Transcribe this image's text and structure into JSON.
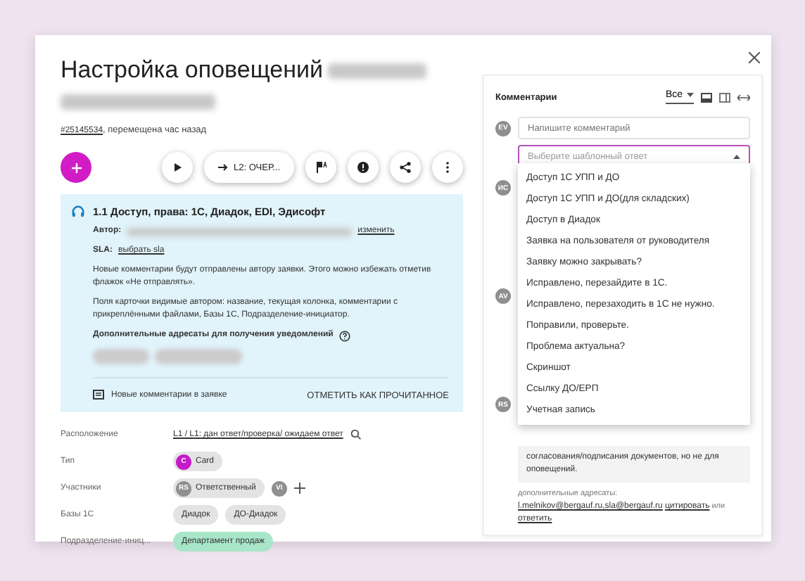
{
  "dialog": {
    "title": "Настройка оповещений",
    "ticket_link": "#25145534",
    "moved": ", перемещена час назад"
  },
  "toolbar": {
    "move_label": "L2: ОЧЕР..."
  },
  "info": {
    "heading": "1.1 Доступ, права: 1С, Диадок, EDI, Эдисофт",
    "author_label": "Автор:",
    "change_link": "изменить",
    "sla_label": "SLA:",
    "sla_link": "выбрать sla",
    "notes": [
      "Новые комментарии будут отправлены автору заявки. Этого можно избежать отметив флажок «Не отправлять».",
      "Поля карточки видимые автором: название, текущая колонка, комментарии с прикреплёнными файлами, Базы 1С, Подразделение-инициатор."
    ],
    "extra_heading": "Дополнительные адресаты для получения уведомлений",
    "new_comments": "Новые комментарии в заявке",
    "mark_read": "ОТМЕТИТЬ КАК ПРОЧИТАННОЕ"
  },
  "fields": [
    {
      "label": "Расположение",
      "kind": "location",
      "value": "L1 / L1: дан ответ/проверка/ ожидаем ответ"
    },
    {
      "label": "Тип",
      "kind": "type",
      "avatar": "C",
      "value": "Card"
    },
    {
      "label": "Участники",
      "kind": "participants",
      "role_initials": "RS",
      "role": "Ответственный",
      "extra_initials": "VI"
    },
    {
      "label": "Базы 1С",
      "kind": "tags",
      "tags": [
        "Диадок",
        "ДО-Диадок"
      ]
    },
    {
      "label": "Подразделение-иниц...",
      "kind": "department",
      "tags": [
        "Департамент продаж"
      ]
    }
  ],
  "comments": {
    "title": "Комментарии",
    "filter": "Все",
    "input_initials": "EV",
    "placeholder": "Напишите комментарий",
    "template_placeholder": "Выберите шаблонный ответ",
    "template_open": true,
    "templates": [
      "Доступ 1С УПП и ДО",
      "Доступ 1С УПП и ДО(для складских)",
      "Доступ в Диадок",
      "Заявка на пользователя от руководителя",
      "Заявку можно закрывать?",
      "Исправлено, перезайдите в 1С.",
      "Исправлено, перезаходить в 1С не нужно.",
      "Поправили, проверьте.",
      "Проблема актуальна?",
      "Скриншот",
      "Ссылку ДО/ЕРП",
      "Учетная запись"
    ],
    "thread": [
      {
        "initials": "ИС"
      },
      {
        "initials": "AV"
      },
      {
        "initials": "RS"
      }
    ],
    "last_text": "согласования/подписания документов, но не для оповещений.",
    "footer_label": "дополнительные адресаты:",
    "footer_emails": "l.melnikov@bergauf.ru,sla@bergauf.ru",
    "quote": "цитировать",
    "or": "или",
    "reply": "ответить"
  }
}
